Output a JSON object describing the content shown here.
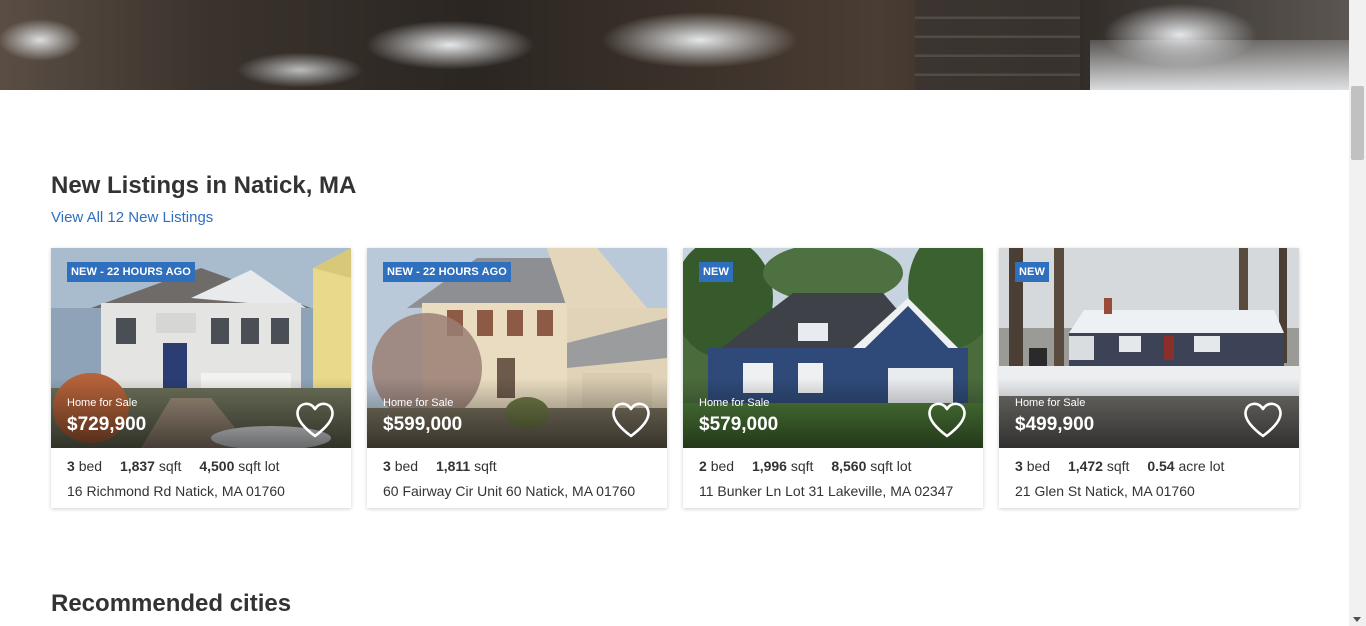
{
  "section": {
    "title": "New Listings in Natick, MA",
    "view_all": "View All 12 New Listings"
  },
  "listings": [
    {
      "badge": "NEW - 22 HOURS AGO",
      "status": "Home for Sale",
      "price": "$729,900",
      "beds": "3",
      "beds_label": "bed",
      "sqft": "1,837",
      "sqft_label": "sqft",
      "lot": "4,500",
      "lot_label": "sqft lot",
      "address": "16 Richmond Rd Natick, MA 01760"
    },
    {
      "badge": "NEW - 22 HOURS AGO",
      "status": "Home for Sale",
      "price": "$599,000",
      "beds": "3",
      "beds_label": "bed",
      "sqft": "1,811",
      "sqft_label": "sqft",
      "address": "60 Fairway Cir Unit 60 Natick, MA 01760"
    },
    {
      "badge": "NEW",
      "status": "Home for Sale",
      "price": "$579,000",
      "beds": "2",
      "beds_label": "bed",
      "sqft": "1,996",
      "sqft_label": "sqft",
      "lot": "8,560",
      "lot_label": "sqft lot",
      "address": "11 Bunker Ln Lot 31 Lakeville, MA 02347"
    },
    {
      "badge": "NEW",
      "status": "Home for Sale",
      "price": "$499,900",
      "beds": "3",
      "beds_label": "bed",
      "sqft": "1,472",
      "sqft_label": "sqft",
      "lot": "0.54",
      "lot_label": "acre lot",
      "address": "21 Glen St Natick, MA 01760"
    }
  ],
  "recommended": {
    "title": "Recommended cities"
  },
  "colors": {
    "accent": "#2e6fbe",
    "text": "#333333"
  },
  "icons": [
    "heart-icon",
    "scroll-down-arrow-icon"
  ]
}
